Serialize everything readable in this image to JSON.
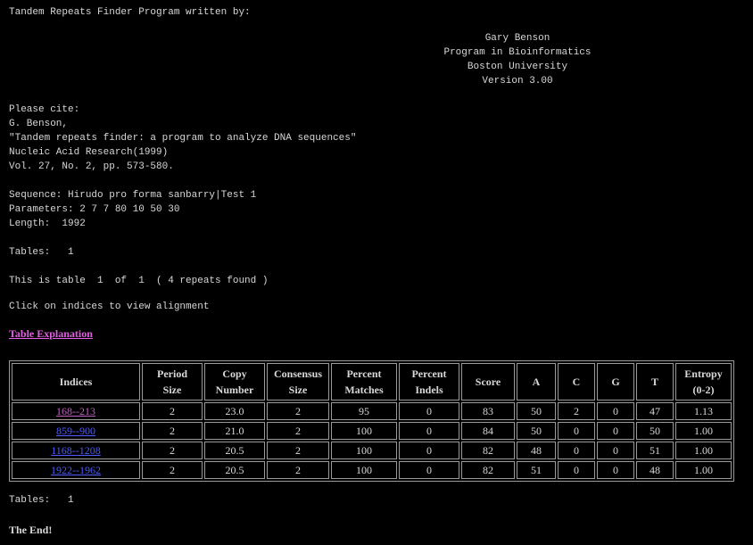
{
  "header": {
    "title_line": "Tandem Repeats Finder Program written by:",
    "author": "Gary Benson",
    "program": "Program in Bioinformatics",
    "university": "Boston University",
    "version": "Version 3.00"
  },
  "citation": {
    "heading": "Please cite:",
    "author": "G. Benson,",
    "title": "\"Tandem repeats finder: a program to analyze DNA sequences\"",
    "journal": "Nucleic Acid Research(1999)",
    "volume": "Vol. 27, No. 2, pp. 573-580."
  },
  "info": {
    "sequence": "Sequence: Hirudo pro forma sanbarry|Test 1",
    "parameters": "Parameters: 2 7 7 80 10 50 30",
    "length": "Length:  1992"
  },
  "tables_line": "Tables:   1",
  "table_position": "This is table  1  of  1  ( 4 repeats found )",
  "instruction": "Click on indices to view alignment",
  "explanation_link": "Table Explanation",
  "table": {
    "headers": [
      "Indices",
      "Period Size",
      "Copy Number",
      "Consensus Size",
      "Percent Matches",
      "Percent Indels",
      "Score",
      "A",
      "C",
      "G",
      "T",
      "Entropy (0-2)"
    ],
    "rows": [
      {
        "indices": "168--213",
        "period": "2",
        "copy": "23.0",
        "consensus": "2",
        "matches": "95",
        "indels": "0",
        "score": "83",
        "a": "50",
        "c": "2",
        "g": "0",
        "t": "47",
        "entropy": "1.13",
        "visited": true
      },
      {
        "indices": "859--900",
        "period": "2",
        "copy": "21.0",
        "consensus": "2",
        "matches": "100",
        "indels": "0",
        "score": "84",
        "a": "50",
        "c": "0",
        "g": "0",
        "t": "50",
        "entropy": "1.00",
        "visited": false
      },
      {
        "indices": "1168--1208",
        "period": "2",
        "copy": "20.5",
        "consensus": "2",
        "matches": "100",
        "indels": "0",
        "score": "82",
        "a": "48",
        "c": "0",
        "g": "0",
        "t": "51",
        "entropy": "1.00",
        "visited": false
      },
      {
        "indices": "1922--1962",
        "period": "2",
        "copy": "20.5",
        "consensus": "2",
        "matches": "100",
        "indels": "0",
        "score": "82",
        "a": "51",
        "c": "0",
        "g": "0",
        "t": "48",
        "entropy": "1.00",
        "visited": false
      }
    ]
  },
  "tables_footer": "Tables:   1",
  "the_end": "The End!"
}
